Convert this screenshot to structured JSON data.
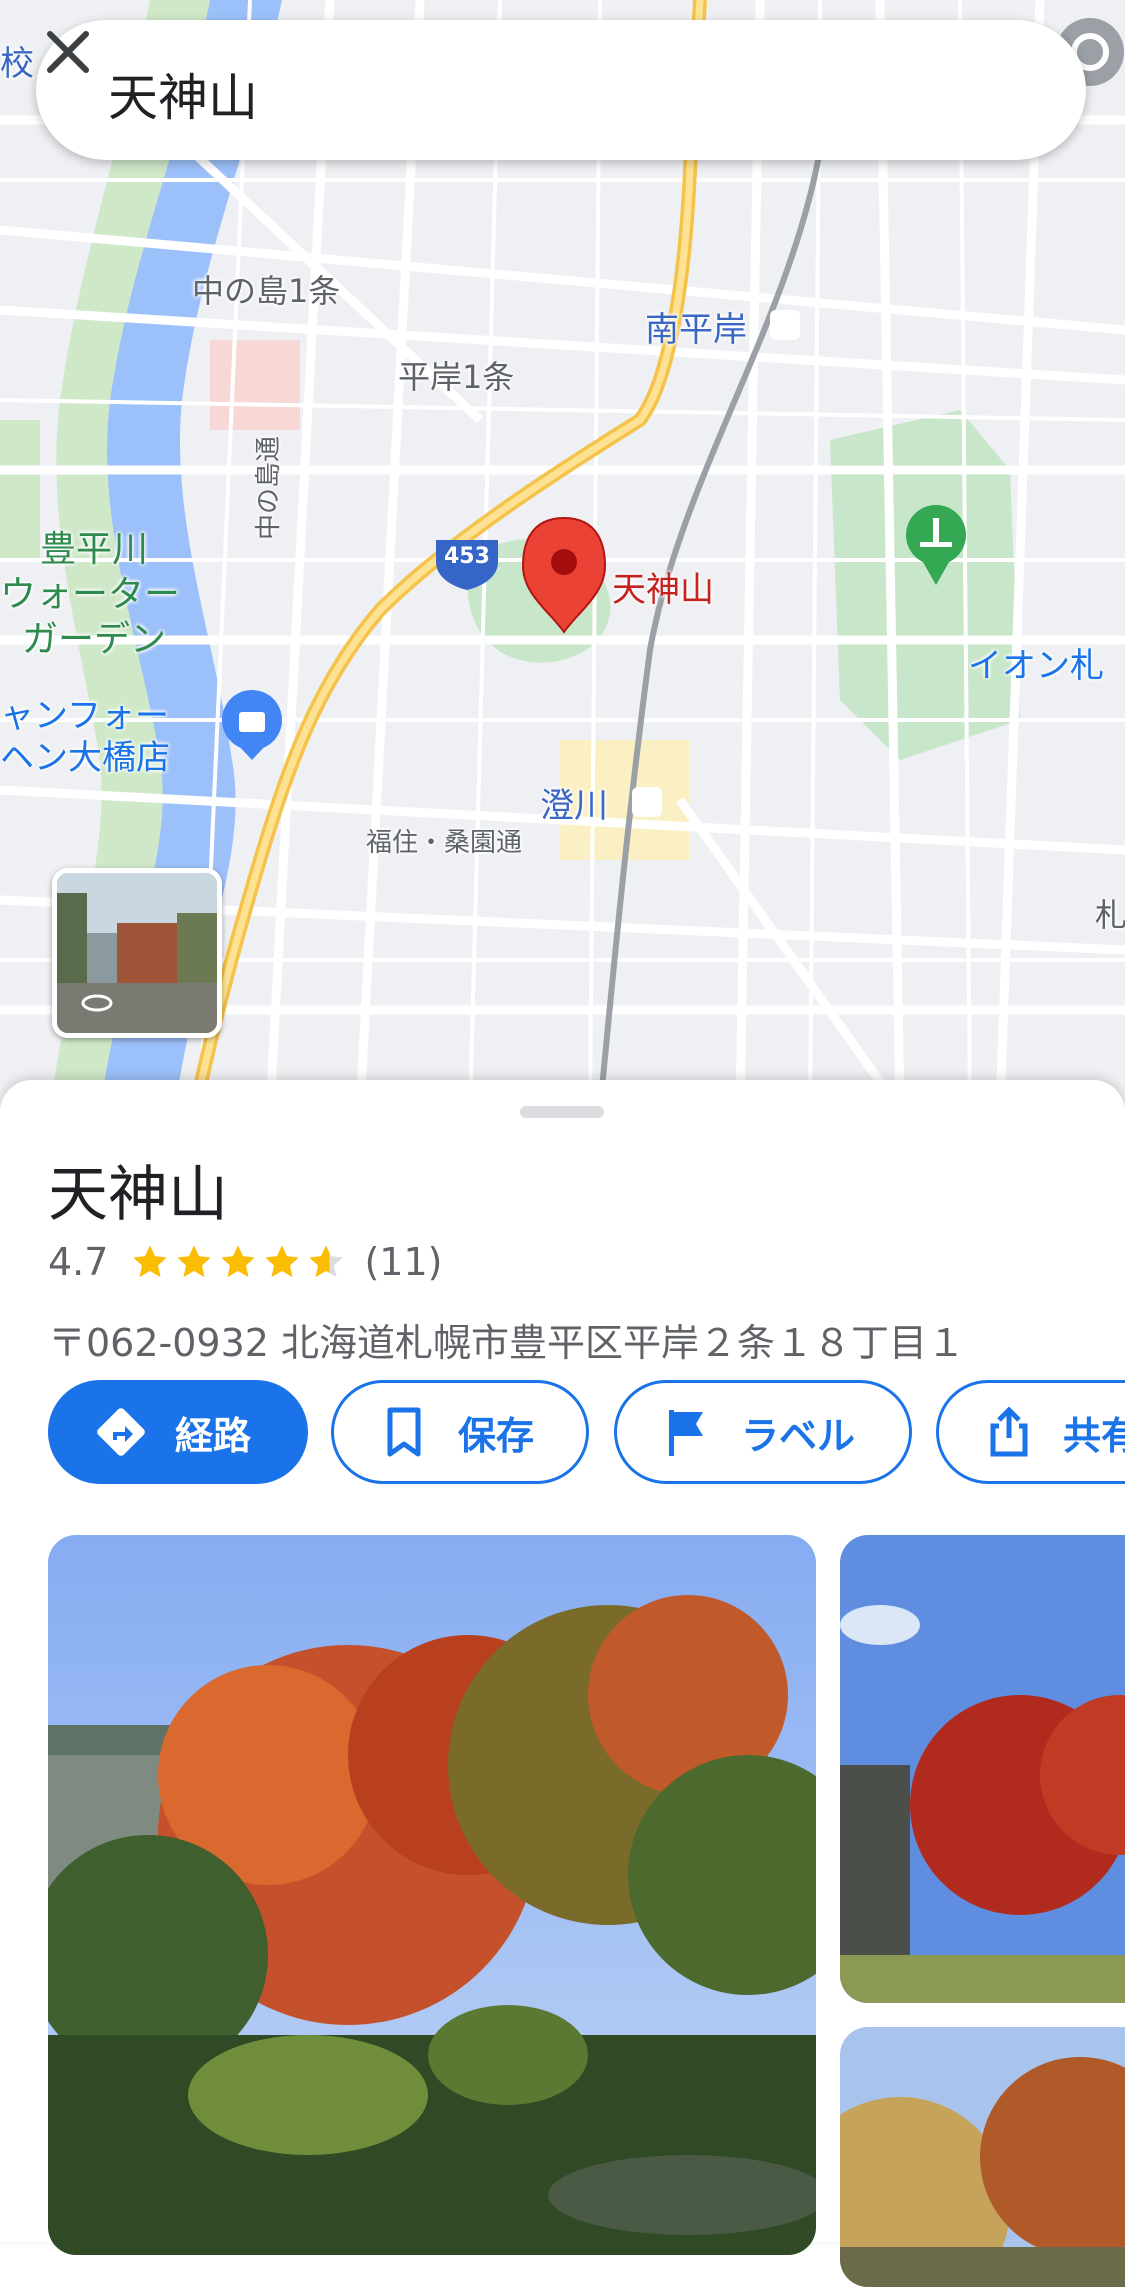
{
  "search": {
    "query": "天神山"
  },
  "map": {
    "labels": {
      "school_fragment": "校",
      "nakanoshima": "中の島1条",
      "minami_hiragishi": "南平岸",
      "hiragishi": "平岸1条",
      "toyohira_river_1": "豊平川",
      "toyohira_river_2": "ウォーター",
      "toyohira_river_3": "ガーデン",
      "nakanoshima_dori": "中の島通",
      "route_number": "453",
      "pin_name": "天神山",
      "aeon": "イオン札",
      "shop_1": "ャンフォー",
      "shop_2": "ヘン大橋店",
      "sumikawa": "澄川",
      "fukuzumi_dori": "福住・桑園通",
      "right_edge": "札"
    }
  },
  "place": {
    "name": "天神山",
    "rating": "4.7",
    "rating_value": 4.7,
    "review_count": "(11)",
    "address": "〒062-0932 北海道札幌市豊平区平岸２条１８丁目１"
  },
  "actions": {
    "directions": "経路",
    "save": "保存",
    "label": "ラベル",
    "share": "共有"
  },
  "colors": {
    "accent": "#1a73e8",
    "star": "#fbbc04",
    "pin": "#ea4335",
    "park": "#c8e6c9"
  }
}
